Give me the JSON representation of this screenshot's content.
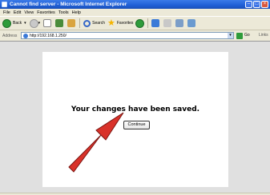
{
  "window": {
    "title": "Cannot find server - Microsoft Internet Explorer"
  },
  "menu": [
    "File",
    "Edit",
    "View",
    "Favorites",
    "Tools",
    "Help"
  ],
  "toolbar": {
    "back_label": "Back",
    "search_label": "Search",
    "favorites_label": "Favorites"
  },
  "address": {
    "label": "Address",
    "url": "http://192.168.1.250/",
    "go_label": "Go",
    "links_label": "Links"
  },
  "page": {
    "message": "Your changes have been saved.",
    "continue_label": "Continue"
  },
  "colors": {
    "titlebar": "#1f5fd6",
    "arrow": "#d9322a",
    "page_bg": "#ffffff"
  }
}
